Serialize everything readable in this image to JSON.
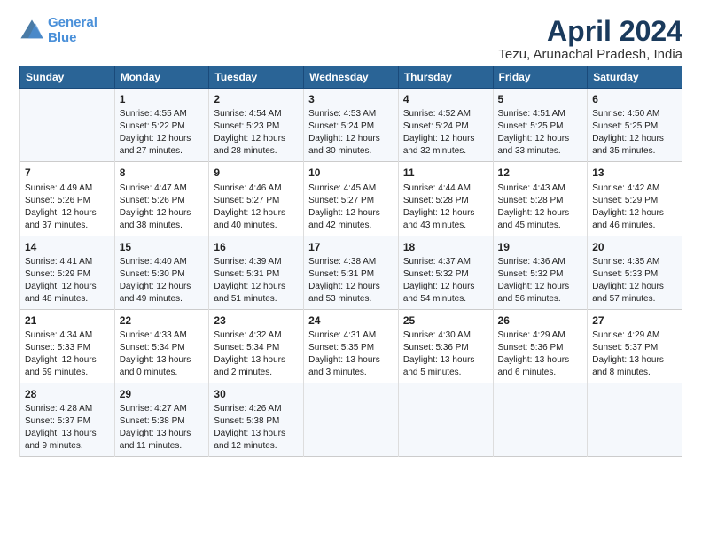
{
  "logo": {
    "line1": "General",
    "line2": "Blue"
  },
  "title": "April 2024",
  "subtitle": "Tezu, Arunachal Pradesh, India",
  "days_header": [
    "Sunday",
    "Monday",
    "Tuesday",
    "Wednesday",
    "Thursday",
    "Friday",
    "Saturday"
  ],
  "weeks": [
    [
      {
        "day": "",
        "content": ""
      },
      {
        "day": "1",
        "content": "Sunrise: 4:55 AM\nSunset: 5:22 PM\nDaylight: 12 hours\nand 27 minutes."
      },
      {
        "day": "2",
        "content": "Sunrise: 4:54 AM\nSunset: 5:23 PM\nDaylight: 12 hours\nand 28 minutes."
      },
      {
        "day": "3",
        "content": "Sunrise: 4:53 AM\nSunset: 5:24 PM\nDaylight: 12 hours\nand 30 minutes."
      },
      {
        "day": "4",
        "content": "Sunrise: 4:52 AM\nSunset: 5:24 PM\nDaylight: 12 hours\nand 32 minutes."
      },
      {
        "day": "5",
        "content": "Sunrise: 4:51 AM\nSunset: 5:25 PM\nDaylight: 12 hours\nand 33 minutes."
      },
      {
        "day": "6",
        "content": "Sunrise: 4:50 AM\nSunset: 5:25 PM\nDaylight: 12 hours\nand 35 minutes."
      }
    ],
    [
      {
        "day": "7",
        "content": "Sunrise: 4:49 AM\nSunset: 5:26 PM\nDaylight: 12 hours\nand 37 minutes."
      },
      {
        "day": "8",
        "content": "Sunrise: 4:47 AM\nSunset: 5:26 PM\nDaylight: 12 hours\nand 38 minutes."
      },
      {
        "day": "9",
        "content": "Sunrise: 4:46 AM\nSunset: 5:27 PM\nDaylight: 12 hours\nand 40 minutes."
      },
      {
        "day": "10",
        "content": "Sunrise: 4:45 AM\nSunset: 5:27 PM\nDaylight: 12 hours\nand 42 minutes."
      },
      {
        "day": "11",
        "content": "Sunrise: 4:44 AM\nSunset: 5:28 PM\nDaylight: 12 hours\nand 43 minutes."
      },
      {
        "day": "12",
        "content": "Sunrise: 4:43 AM\nSunset: 5:28 PM\nDaylight: 12 hours\nand 45 minutes."
      },
      {
        "day": "13",
        "content": "Sunrise: 4:42 AM\nSunset: 5:29 PM\nDaylight: 12 hours\nand 46 minutes."
      }
    ],
    [
      {
        "day": "14",
        "content": "Sunrise: 4:41 AM\nSunset: 5:29 PM\nDaylight: 12 hours\nand 48 minutes."
      },
      {
        "day": "15",
        "content": "Sunrise: 4:40 AM\nSunset: 5:30 PM\nDaylight: 12 hours\nand 49 minutes."
      },
      {
        "day": "16",
        "content": "Sunrise: 4:39 AM\nSunset: 5:31 PM\nDaylight: 12 hours\nand 51 minutes."
      },
      {
        "day": "17",
        "content": "Sunrise: 4:38 AM\nSunset: 5:31 PM\nDaylight: 12 hours\nand 53 minutes."
      },
      {
        "day": "18",
        "content": "Sunrise: 4:37 AM\nSunset: 5:32 PM\nDaylight: 12 hours\nand 54 minutes."
      },
      {
        "day": "19",
        "content": "Sunrise: 4:36 AM\nSunset: 5:32 PM\nDaylight: 12 hours\nand 56 minutes."
      },
      {
        "day": "20",
        "content": "Sunrise: 4:35 AM\nSunset: 5:33 PM\nDaylight: 12 hours\nand 57 minutes."
      }
    ],
    [
      {
        "day": "21",
        "content": "Sunrise: 4:34 AM\nSunset: 5:33 PM\nDaylight: 12 hours\nand 59 minutes."
      },
      {
        "day": "22",
        "content": "Sunrise: 4:33 AM\nSunset: 5:34 PM\nDaylight: 13 hours\nand 0 minutes."
      },
      {
        "day": "23",
        "content": "Sunrise: 4:32 AM\nSunset: 5:34 PM\nDaylight: 13 hours\nand 2 minutes."
      },
      {
        "day": "24",
        "content": "Sunrise: 4:31 AM\nSunset: 5:35 PM\nDaylight: 13 hours\nand 3 minutes."
      },
      {
        "day": "25",
        "content": "Sunrise: 4:30 AM\nSunset: 5:36 PM\nDaylight: 13 hours\nand 5 minutes."
      },
      {
        "day": "26",
        "content": "Sunrise: 4:29 AM\nSunset: 5:36 PM\nDaylight: 13 hours\nand 6 minutes."
      },
      {
        "day": "27",
        "content": "Sunrise: 4:29 AM\nSunset: 5:37 PM\nDaylight: 13 hours\nand 8 minutes."
      }
    ],
    [
      {
        "day": "28",
        "content": "Sunrise: 4:28 AM\nSunset: 5:37 PM\nDaylight: 13 hours\nand 9 minutes."
      },
      {
        "day": "29",
        "content": "Sunrise: 4:27 AM\nSunset: 5:38 PM\nDaylight: 13 hours\nand 11 minutes."
      },
      {
        "day": "30",
        "content": "Sunrise: 4:26 AM\nSunset: 5:38 PM\nDaylight: 13 hours\nand 12 minutes."
      },
      {
        "day": "",
        "content": ""
      },
      {
        "day": "",
        "content": ""
      },
      {
        "day": "",
        "content": ""
      },
      {
        "day": "",
        "content": ""
      }
    ]
  ]
}
